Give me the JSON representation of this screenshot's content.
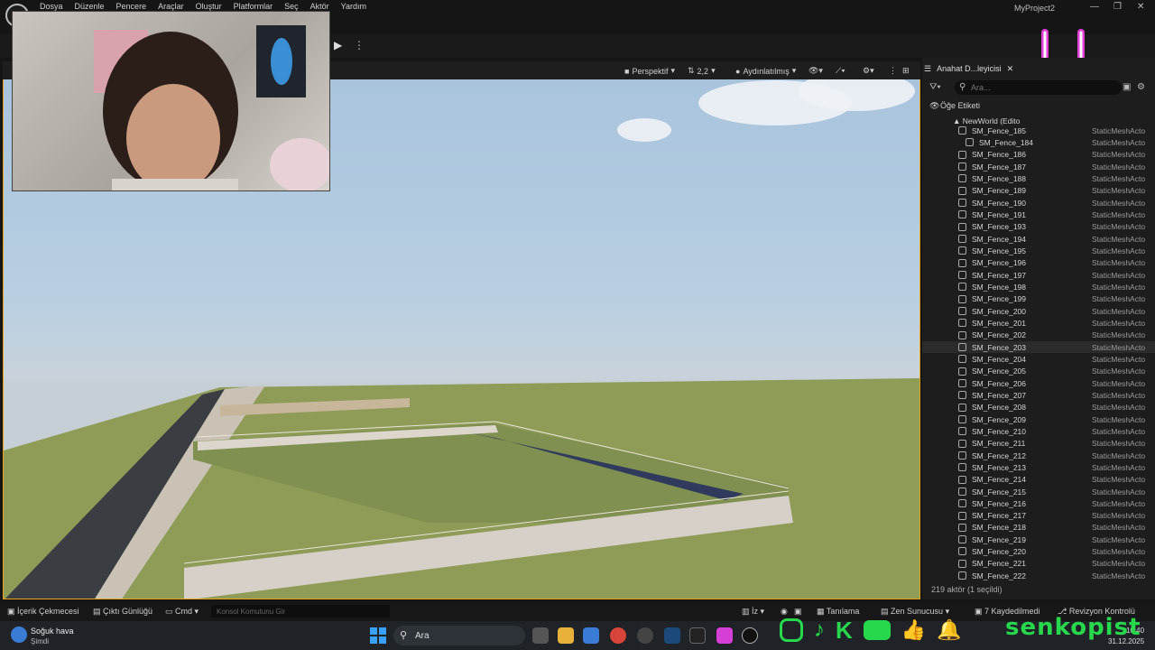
{
  "menubar": {
    "items": [
      "Dosya",
      "Düzenle",
      "Pencere",
      "Araçlar",
      "Oluştur",
      "Platformlar",
      "Seç",
      "Aktör",
      "Yardım"
    ],
    "project": "MyProject2"
  },
  "viewport": {
    "perspective_label": "Perspektif",
    "fov_label": "2,2",
    "lighting_label": "Aydınlatılmış"
  },
  "outliner": {
    "tab_title": "Anahat D...leyicisi",
    "search_placeholder": "Ara...",
    "column_label": "Öğe Etiketi",
    "root_label": "NewWorld (Edito",
    "rows": [
      {
        "name": "SM_Fence_185",
        "type": "StaticMeshActo"
      },
      {
        "name": "SM_Fence_184",
        "type": "StaticMeshActo"
      },
      {
        "name": "SM_Fence_186",
        "type": "StaticMeshActo"
      },
      {
        "name": "SM_Fence_187",
        "type": "StaticMeshActo"
      },
      {
        "name": "SM_Fence_188",
        "type": "StaticMeshActo"
      },
      {
        "name": "SM_Fence_189",
        "type": "StaticMeshActo"
      },
      {
        "name": "SM_Fence_190",
        "type": "StaticMeshActo"
      },
      {
        "name": "SM_Fence_191",
        "type": "StaticMeshActo"
      },
      {
        "name": "SM_Fence_193",
        "type": "StaticMeshActo"
      },
      {
        "name": "SM_Fence_194",
        "type": "StaticMeshActo"
      },
      {
        "name": "SM_Fence_195",
        "type": "StaticMeshActo"
      },
      {
        "name": "SM_Fence_196",
        "type": "StaticMeshActo"
      },
      {
        "name": "SM_Fence_197",
        "type": "StaticMeshActo"
      },
      {
        "name": "SM_Fence_198",
        "type": "StaticMeshActo"
      },
      {
        "name": "SM_Fence_199",
        "type": "StaticMeshActo"
      },
      {
        "name": "SM_Fence_200",
        "type": "StaticMeshActo"
      },
      {
        "name": "SM_Fence_201",
        "type": "StaticMeshActo"
      },
      {
        "name": "SM_Fence_202",
        "type": "StaticMeshActo"
      },
      {
        "name": "SM_Fence_203",
        "type": "StaticMeshActo"
      },
      {
        "name": "SM_Fence_204",
        "type": "StaticMeshActo"
      },
      {
        "name": "SM_Fence_205",
        "type": "StaticMeshActo"
      },
      {
        "name": "SM_Fence_206",
        "type": "StaticMeshActo"
      },
      {
        "name": "SM_Fence_207",
        "type": "StaticMeshActo"
      },
      {
        "name": "SM_Fence_208",
        "type": "StaticMeshActo"
      },
      {
        "name": "SM_Fence_209",
        "type": "StaticMeshActo"
      },
      {
        "name": "SM_Fence_210",
        "type": "StaticMeshActo"
      },
      {
        "name": "SM_Fence_211",
        "type": "StaticMeshActo"
      },
      {
        "name": "SM_Fence_212",
        "type": "StaticMeshActo"
      },
      {
        "name": "SM_Fence_213",
        "type": "StaticMeshActo"
      },
      {
        "name": "SM_Fence_214",
        "type": "StaticMeshActo"
      },
      {
        "name": "SM_Fence_215",
        "type": "StaticMeshActo"
      },
      {
        "name": "SM_Fence_216",
        "type": "StaticMeshActo"
      },
      {
        "name": "SM_Fence_217",
        "type": "StaticMeshActo"
      },
      {
        "name": "SM_Fence_218",
        "type": "StaticMeshActo"
      },
      {
        "name": "SM_Fence_219",
        "type": "StaticMeshActo"
      },
      {
        "name": "SM_Fence_220",
        "type": "StaticMeshActo"
      },
      {
        "name": "SM_Fence_221",
        "type": "StaticMeshActo"
      },
      {
        "name": "SM_Fence_222",
        "type": "StaticMeshActo"
      }
    ],
    "footer": "219 aktör (1 seçildi)"
  },
  "statusbar": {
    "content_drawer": "İçerik Çekmecesi",
    "output_log": "Çıktı Günlüğü",
    "cmd": "Cmd",
    "console_placeholder": "Konsol Komutunu Gir",
    "iz": "İz",
    "tanilama": "Tanılama",
    "zen": "Zen Sunucusu",
    "saved": "7 Kaydedilmedi",
    "revision": "Revizyon Kontrolü"
  },
  "taskbar": {
    "weather_title": "Soğuk hava",
    "weather_sub": "Şimdi",
    "search": "Ara",
    "time": "10:40",
    "date": "31.12.2025"
  },
  "overlay": {
    "brand": "senkopist"
  },
  "colors": {
    "accent": "#e8a21a",
    "brand_green": "#27d84c",
    "smiley_pink": "#e23cd6"
  }
}
